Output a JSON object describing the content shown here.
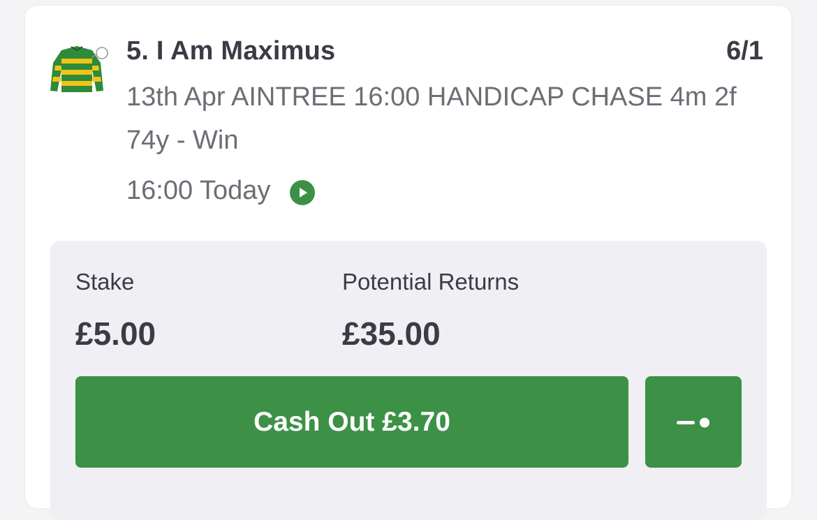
{
  "selection": {
    "name": "5. I Am Maximus",
    "odds": "6/1",
    "event_description": "13th Apr AINTREE 16:00 HANDICAP CHASE 4m 2f 74y - Win",
    "start_time": "16:00 Today",
    "silks_icon": "jockey-silks-icon",
    "live_icon": "play-circle-icon"
  },
  "bet": {
    "stake_label": "Stake",
    "stake_value": "£5.00",
    "returns_label": "Potential Returns",
    "returns_value": "£35.00",
    "cashout_label": "Cash Out £3.70",
    "partial_icon": "slider-toggle-icon"
  },
  "colors": {
    "accent_green": "#3c9146",
    "silks_green": "#2f8a3a",
    "silks_yellow": "#f2c417",
    "text_dark": "#3a3b45",
    "text_muted": "#6c6d75",
    "panel_bg": "#efeff4"
  }
}
